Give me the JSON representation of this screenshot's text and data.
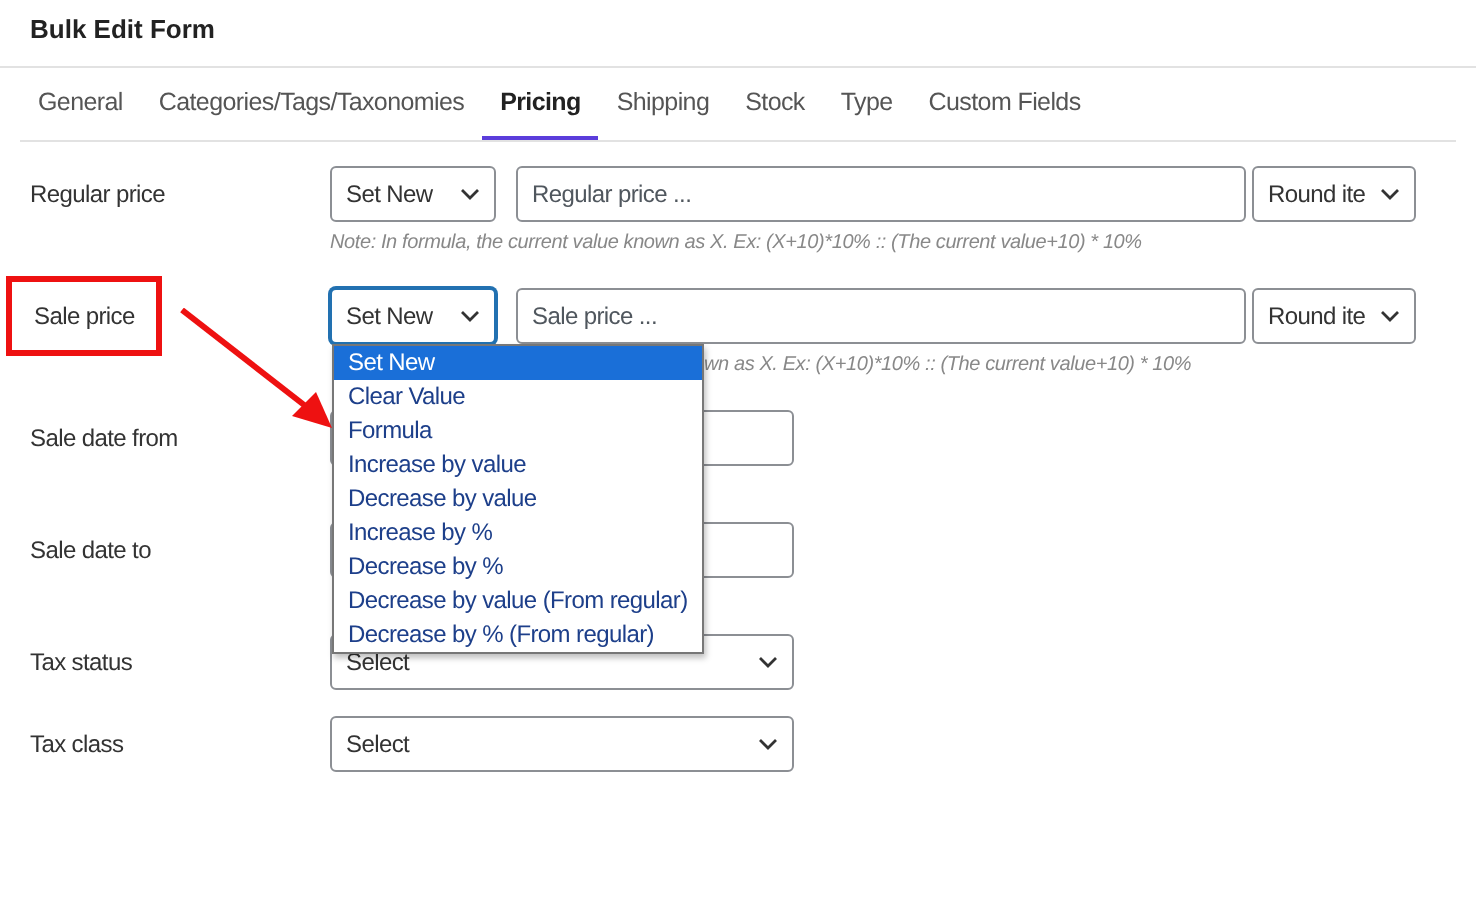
{
  "title": "Bulk Edit Form",
  "tabs": [
    {
      "label": "General",
      "selected": false
    },
    {
      "label": "Categories/Tags/Taxonomies",
      "selected": false
    },
    {
      "label": "Pricing",
      "selected": true
    },
    {
      "label": "Shipping",
      "selected": false
    },
    {
      "label": "Stock",
      "selected": false
    },
    {
      "label": "Type",
      "selected": false
    },
    {
      "label": "Custom Fields",
      "selected": false
    }
  ],
  "fields": [
    {
      "kind": "price",
      "label": "Regular price",
      "highlighted": false,
      "mode": "Set New",
      "focused": false,
      "placeholder": "Regular price ...",
      "round": "Round ite",
      "hint": "Note: In formula, the current value known as X. Ex: (X+10)*10% :: (The current value+10) * 10%"
    },
    {
      "kind": "price",
      "label": "Sale price",
      "highlighted": true,
      "mode": "Set New",
      "focused": true,
      "placeholder": "Sale price ...",
      "round": "Round ite",
      "hint": "wn as X. Ex: (X+10)*10% :: (The current value+10) * 10%",
      "dropdown": [
        {
          "label": "Set New",
          "selected": true
        },
        {
          "label": "Clear Value",
          "selected": false
        },
        {
          "label": "Formula",
          "selected": false
        },
        {
          "label": "Increase by value",
          "selected": false
        },
        {
          "label": "Decrease by value",
          "selected": false
        },
        {
          "label": "Increase by %",
          "selected": false
        },
        {
          "label": "Decrease by %",
          "selected": false
        },
        {
          "label": "Decrease by value (From regular)",
          "selected": false
        },
        {
          "label": "Decrease by % (From regular)",
          "selected": false
        }
      ]
    },
    {
      "kind": "date",
      "label": "Sale date from"
    },
    {
      "kind": "date",
      "label": "Sale date to"
    },
    {
      "kind": "select",
      "label": "Tax status",
      "value": "Select"
    },
    {
      "kind": "select",
      "label": "Tax class",
      "value": "Select"
    }
  ]
}
